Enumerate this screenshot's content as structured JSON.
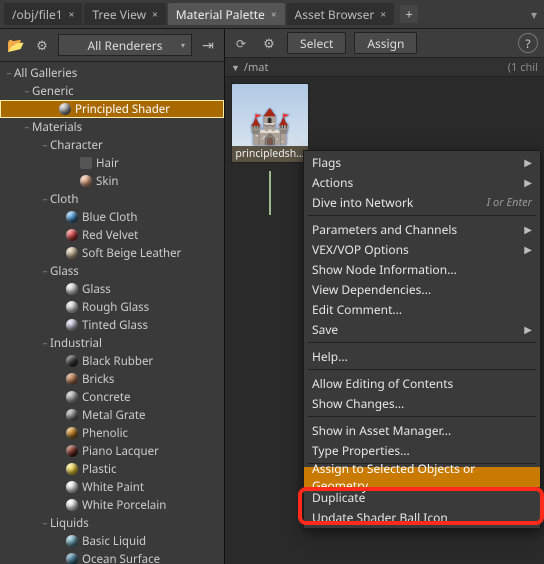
{
  "tabs": {
    "items": [
      {
        "label": "/obj/file1",
        "active": false
      },
      {
        "label": "Tree View",
        "active": false
      },
      {
        "label": "Material Palette",
        "active": true
      },
      {
        "label": "Asset Browser",
        "active": false
      }
    ]
  },
  "left_toolbar": {
    "renderer_label": "All Renderers"
  },
  "tree": {
    "root": "All Galleries",
    "generic": {
      "label": "Generic",
      "principled": "Principled Shader"
    },
    "materials": {
      "label": "Materials"
    },
    "groups": {
      "character": {
        "label": "Character",
        "items": [
          {
            "label": "Hair",
            "icon": "sp-hair"
          },
          {
            "label": "Skin",
            "icon": "sp-skin"
          }
        ]
      },
      "cloth": {
        "label": "Cloth",
        "items": [
          {
            "label": "Blue Cloth",
            "icon": "sp-blue"
          },
          {
            "label": "Red Velvet",
            "icon": "sp-red"
          },
          {
            "label": "Soft Beige Leather",
            "icon": "sp-beige"
          }
        ]
      },
      "glass": {
        "label": "Glass",
        "items": [
          {
            "label": "Glass",
            "icon": "sp-glass"
          },
          {
            "label": "Rough Glass",
            "icon": "sp-glass"
          },
          {
            "label": "Tinted Glass",
            "icon": "sp-tint"
          }
        ]
      },
      "industrial": {
        "label": "Industrial",
        "items": [
          {
            "label": "Black Rubber",
            "icon": "sp-black"
          },
          {
            "label": "Bricks",
            "icon": "sp-brick"
          },
          {
            "label": "Concrete",
            "icon": "sp-conc"
          },
          {
            "label": "Metal Grate",
            "icon": "sp-metal"
          },
          {
            "label": "Phenolic",
            "icon": "sp-phen"
          },
          {
            "label": "Piano Lacquer",
            "icon": "sp-piano"
          },
          {
            "label": "Plastic",
            "icon": "sp-plast"
          },
          {
            "label": "White Paint",
            "icon": "sp-white"
          },
          {
            "label": "White Porcelain",
            "icon": "sp-white"
          }
        ]
      },
      "liquids": {
        "label": "Liquids",
        "items": [
          {
            "label": "Basic Liquid",
            "icon": "sp-liq"
          },
          {
            "label": "Ocean Surface",
            "icon": "sp-ocean"
          }
        ]
      }
    }
  },
  "right_toolbar": {
    "select": "Select",
    "assign": "Assign"
  },
  "path": {
    "value": "/mat",
    "count": "(1 chil"
  },
  "node": {
    "label": "principledsh..."
  },
  "context_menu": {
    "flags": "Flags",
    "actions": "Actions",
    "dive": "Dive into Network",
    "dive_hint": "I or Enter",
    "params": "Parameters and Channels",
    "vex": "VEX/VOP Options",
    "nodeinfo": "Show Node Information...",
    "deps": "View Dependencies...",
    "edit": "Edit Comment...",
    "save": "Save",
    "help": "Help...",
    "allowedit": "Allow Editing of Contents",
    "changes": "Show Changes...",
    "assetmgr": "Show in Asset Manager...",
    "typeprops": "Type Properties...",
    "assign_sel": "Assign to Selected Objects or Geometry",
    "duplicate": "Duplicate",
    "shaderball": "Update Shader Ball Icon"
  }
}
